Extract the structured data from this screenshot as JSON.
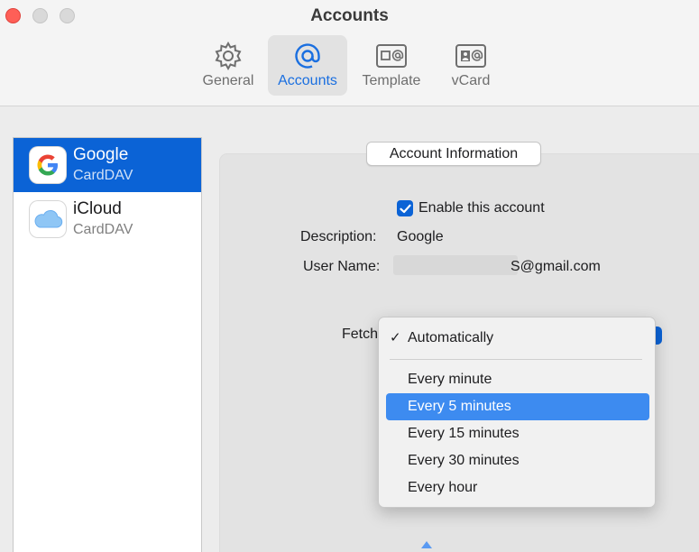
{
  "window": {
    "title": "Accounts"
  },
  "toolbar": {
    "tabs": [
      {
        "label": "General",
        "icon": "gear-icon"
      },
      {
        "label": "Accounts",
        "icon": "at-sign-icon",
        "selected": true
      },
      {
        "label": "Template",
        "icon": "template-card-icon"
      },
      {
        "label": "vCard",
        "icon": "vcard-icon"
      }
    ]
  },
  "sidebar": {
    "accounts": [
      {
        "name": "Google",
        "type": "CardDAV",
        "icon": "google-logo-icon",
        "selected": true
      },
      {
        "name": "iCloud",
        "type": "CardDAV",
        "icon": "icloud-icon"
      }
    ]
  },
  "account_info": {
    "section_title": "Account Information",
    "enable_label": "Enable this account",
    "enable_checked": true,
    "description_label": "Description:",
    "description_value": "Google",
    "username_label": "User Name:",
    "username_value": "S@gmail.com",
    "fetch_label": "Fetch"
  },
  "fetch_menu": {
    "selected_value": "Automatically",
    "highlighted": "Every 5 minutes",
    "options": [
      "Automatically",
      "Every minute",
      "Every 5 minutes",
      "Every 15 minutes",
      "Every 30 minutes",
      "Every hour"
    ]
  },
  "colors": {
    "accent": "#0b63d6",
    "menu_highlight": "#3d8bf0",
    "close_button": "#fe5f57"
  }
}
